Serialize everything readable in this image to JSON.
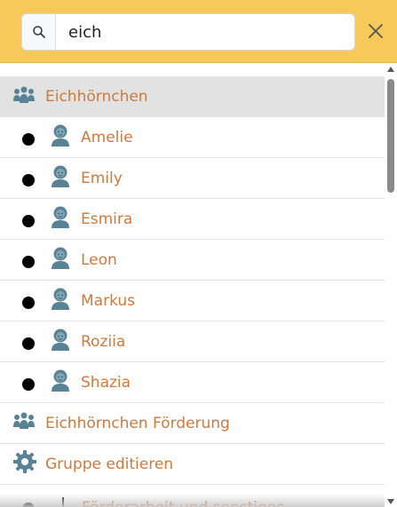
{
  "search": {
    "value": "eich",
    "icon": "search-icon"
  },
  "close_icon": "close-icon",
  "colors": {
    "header_bg": "#f7c95a",
    "label_text": "#cd7a3e",
    "icon_blue": "#5a8295",
    "selected_bg": "#e2e2e2"
  },
  "groups": [
    {
      "label": "Eichhörnchen",
      "icon": "group-icon",
      "selected": true,
      "members": [
        "Amelie",
        "Emily",
        "Esmira",
        "Leon",
        "Markus",
        "Roziia",
        "Shazia"
      ]
    },
    {
      "label": "Eichhörnchen Förderung",
      "icon": "group-icon",
      "selected": false,
      "members": []
    }
  ],
  "actions": {
    "edit_group_label": "Gruppe editieren",
    "edit_group_icon": "gear-icon"
  },
  "partial_row_text": "Förderarbeit und sonstiges"
}
